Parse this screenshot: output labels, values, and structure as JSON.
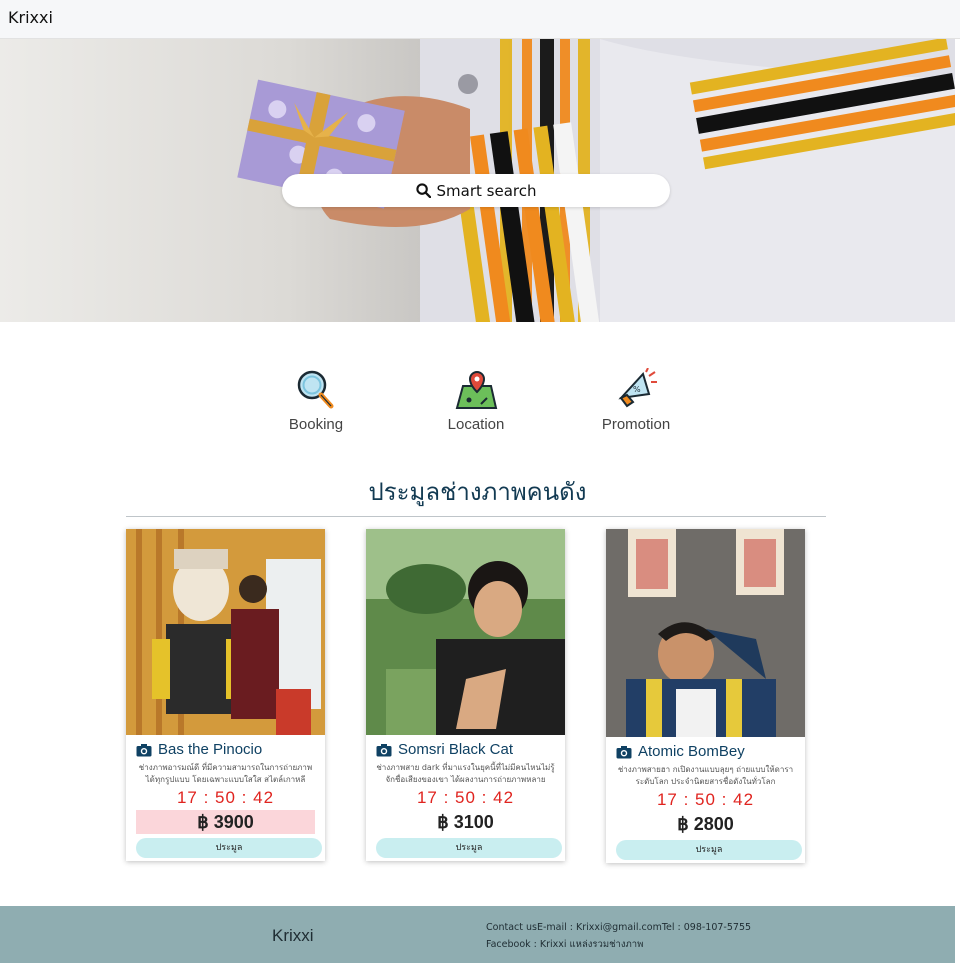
{
  "navbar": {
    "brand": "Krixxi"
  },
  "hero": {
    "search_label": "Smart search"
  },
  "menu": [
    {
      "label": "Booking",
      "icon": "magnifier-icon"
    },
    {
      "label": "Location",
      "icon": "map-pin-icon"
    },
    {
      "label": "Promotion",
      "icon": "megaphone-icon"
    }
  ],
  "section": {
    "title": "ประมูลช่างภาพคนดัง"
  },
  "cards": [
    {
      "name": "Bas the Pinocio",
      "desc": "ช่างภาพอารมณ์ดี ที่มีความสามารถในการถ่ายภาพได้ทุกรูปแบบ โดยเฉพาะแบบใสใส สไตล์เกาหลี",
      "timer": "17 : 50 : 42",
      "price": "฿ 3900",
      "button": "ประมูล"
    },
    {
      "name": "Somsri Black Cat",
      "desc": "ช่างภาพสาย dark ที่มาแรงในยุคนี้ที่ไม่มีคนไหนไม่รู้จักชื่อเสียงของเขา ได้ผลงานการถ่ายภาพหลายสถาบัน",
      "timer": "17 : 50 : 42",
      "price": "฿ 3100",
      "button": "ประมูล"
    },
    {
      "name": "Atomic BomBey",
      "desc": "ช่างภาพสายฮา กเปิดงานแบบลุยๆ ถ่ายแบบให้ดาราระดับโลก ประจำนิตยสารชื่อดังในทั่วโลก",
      "timer": "17 : 50 : 42",
      "price": "฿ 2800",
      "button": "ประมูล"
    }
  ],
  "footer": {
    "brand": "Krixxi",
    "contact": "Contact usE-mail : Krixxi@gmail.comTel : 098-107-5755",
    "facebook": "Facebook : Krixxi แหล่งรวมช่างภาพ"
  },
  "colors": {
    "title": "#123a52",
    "timer": "#e0241f",
    "button": "#c9eef0",
    "footer": "#8fadb1",
    "price_highlight": "#fbd6da"
  }
}
